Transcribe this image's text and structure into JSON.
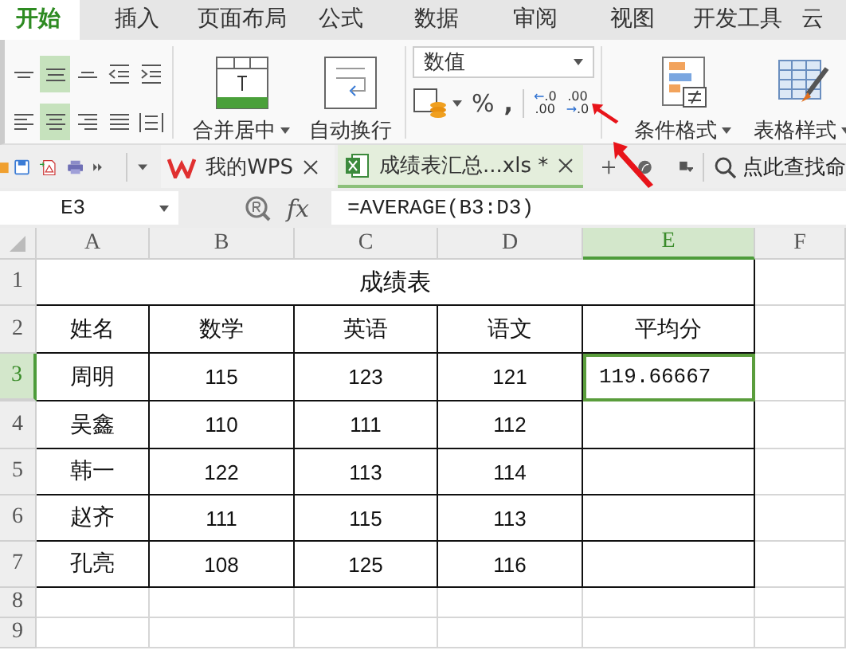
{
  "ribbon_tabs": [
    {
      "label": "开始",
      "selected": true
    },
    {
      "label": "插入",
      "selected": false
    },
    {
      "label": "页面布局",
      "selected": false
    },
    {
      "label": "公式",
      "selected": false
    },
    {
      "label": "数据",
      "selected": false
    },
    {
      "label": "审阅",
      "selected": false
    },
    {
      "label": "视图",
      "selected": false
    },
    {
      "label": "开发工具",
      "selected": false
    },
    {
      "label": "云",
      "selected": false
    }
  ],
  "ribbon": {
    "align_buttons": [
      {
        "kind": "top",
        "selected": false
      },
      {
        "kind": "middle",
        "selected": true
      },
      {
        "kind": "bottom",
        "selected": false
      },
      {
        "kind": "outdent",
        "selected": false
      },
      {
        "kind": "indent",
        "selected": false
      },
      {
        "kind": "left",
        "selected": false
      },
      {
        "kind": "center",
        "selected": true
      },
      {
        "kind": "right",
        "selected": false
      },
      {
        "kind": "justify",
        "selected": false
      },
      {
        "kind": "distribute",
        "selected": false
      }
    ],
    "merge_button": "合并居中",
    "wrap_button": "自动换行",
    "number_format": "数值",
    "percent_button": "%",
    "comma_button": ",",
    "decimal_buttons": [
      {
        "arrow": "←",
        "top": ".0",
        "bottom": ".00"
      },
      {
        "arrow": "→",
        "top": ".00",
        "bottom": ".0"
      }
    ],
    "conditional_format_button": "条件格式",
    "table_style_button": "表格样式"
  },
  "document_tabs": [
    {
      "kind": "home",
      "label": "我的WPS",
      "selected": false
    },
    {
      "kind": "sheet",
      "label": "成绩表汇总...xls *",
      "selected": true
    }
  ],
  "search": {
    "placeholder": "点此查找命"
  },
  "formula_bar": {
    "name_box": "E3",
    "fx": "fx",
    "formula": "=AVERAGE(B3:D3)"
  },
  "sheet": {
    "columns": [
      {
        "label": "A",
        "selected": false
      },
      {
        "label": "B",
        "selected": false
      },
      {
        "label": "C",
        "selected": false
      },
      {
        "label": "D",
        "selected": false
      },
      {
        "label": "E",
        "selected": true
      },
      {
        "label": "F",
        "selected": false
      }
    ],
    "rows": [
      {
        "header": "1",
        "kind": "title",
        "selected": false,
        "text": "成绩表"
      },
      {
        "header": "2",
        "kind": "data",
        "selected": false,
        "cells": [
          {
            "text": "姓名",
            "selected": false
          },
          {
            "text": "数学",
            "selected": false
          },
          {
            "text": "英语",
            "selected": false
          },
          {
            "text": "语文",
            "selected": false
          },
          {
            "text": "平均分",
            "selected": false
          }
        ]
      },
      {
        "header": "3",
        "kind": "data",
        "selected": true,
        "cells": [
          {
            "text": "周明",
            "selected": false
          },
          {
            "text": "115",
            "selected": false
          },
          {
            "text": "123",
            "selected": false
          },
          {
            "text": "121",
            "selected": false
          },
          {
            "text": "119.66667",
            "selected": true
          }
        ]
      },
      {
        "header": "4",
        "kind": "data",
        "selected": false,
        "cells": [
          {
            "text": "吴鑫",
            "selected": false
          },
          {
            "text": "110",
            "selected": false
          },
          {
            "text": "111",
            "selected": false
          },
          {
            "text": "112",
            "selected": false
          },
          {
            "selected": false
          }
        ]
      },
      {
        "header": "5",
        "kind": "data",
        "selected": false,
        "cells": [
          {
            "text": "韩一",
            "selected": false
          },
          {
            "text": "122",
            "selected": false
          },
          {
            "text": "113",
            "selected": false
          },
          {
            "text": "114",
            "selected": false
          },
          {
            "selected": false
          }
        ]
      },
      {
        "header": "6",
        "kind": "data",
        "selected": false,
        "cells": [
          {
            "text": "赵齐",
            "selected": false
          },
          {
            "text": "111",
            "selected": false
          },
          {
            "text": "115",
            "selected": false
          },
          {
            "text": "113",
            "selected": false
          },
          {
            "selected": false
          }
        ]
      },
      {
        "header": "7",
        "kind": "data",
        "selected": false,
        "cells": [
          {
            "text": "孔亮",
            "selected": false
          },
          {
            "text": "108",
            "selected": false
          },
          {
            "text": "125",
            "selected": false
          },
          {
            "text": "116",
            "selected": false
          },
          {
            "selected": false
          }
        ]
      },
      {
        "header": "8",
        "kind": "blank",
        "selected": false
      },
      {
        "header": "9",
        "kind": "blank",
        "selected": false
      }
    ]
  }
}
